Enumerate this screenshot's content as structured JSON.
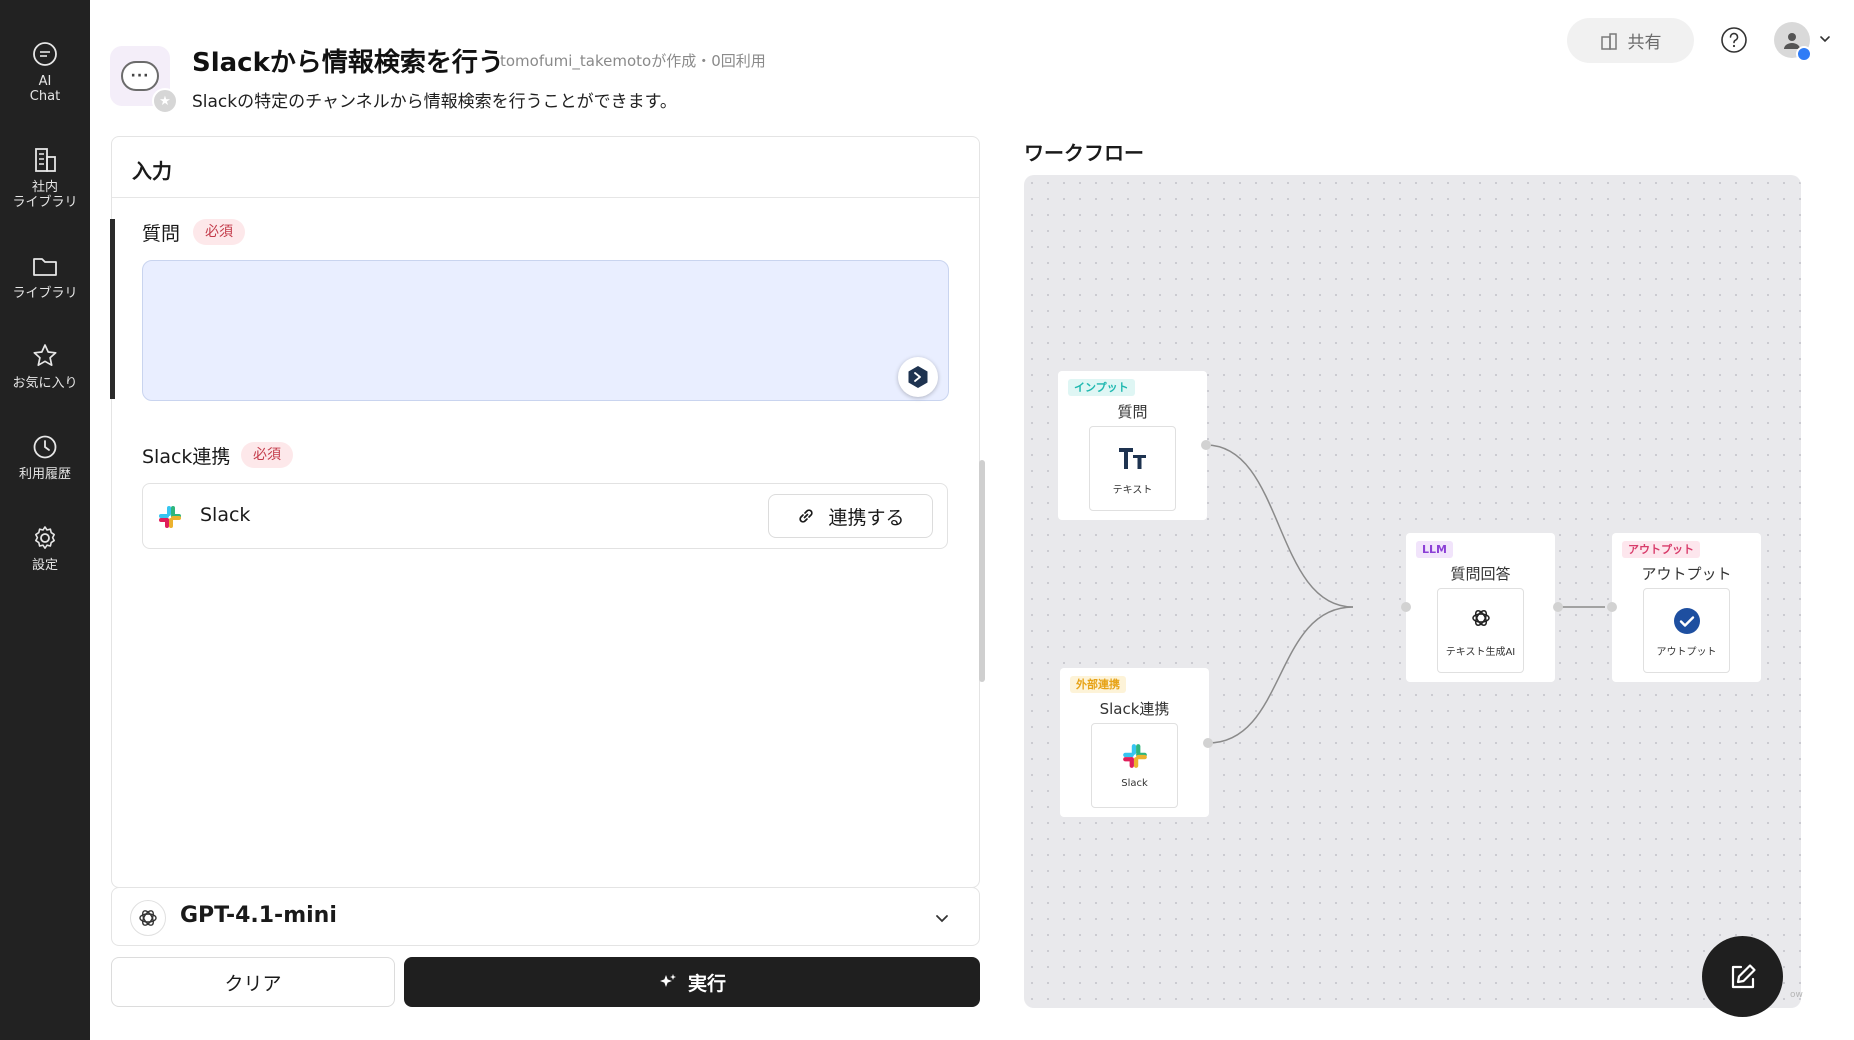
{
  "sidebar": {
    "items": [
      {
        "label": "AI\nChat",
        "icon": "chat-bubble-icon"
      },
      {
        "label": "社内\nライブラリ",
        "icon": "building-icon"
      },
      {
        "label": "ライブラリ",
        "icon": "folder-icon"
      },
      {
        "label": "お気に入り",
        "icon": "star-icon"
      },
      {
        "label": "利用履歴",
        "icon": "clock-icon"
      },
      {
        "label": "設定",
        "icon": "gear-icon"
      }
    ]
  },
  "header": {
    "title": "Slackから情報検索を行う",
    "meta": "tomofumi_takemotoが作成・0回利用",
    "description": "Slackの特定のチャンネルから情報検索を行うことができます。",
    "share_label": "共有"
  },
  "input_card": {
    "title": "入力",
    "question": {
      "label": "質問",
      "required": "必須",
      "value": "",
      "placeholder": ""
    },
    "slack": {
      "label": "Slack連携",
      "required": "必須",
      "service_name": "Slack",
      "connect_label": "連携する"
    }
  },
  "model": {
    "name": "GPT-4.1-mini"
  },
  "actions": {
    "clear_label": "クリア",
    "run_label": "実行"
  },
  "workflow": {
    "title": "ワークフロー",
    "nodes": {
      "input": {
        "tag": "インプット",
        "title": "質問",
        "inner_label": "テキスト"
      },
      "external": {
        "tag": "外部連携",
        "title": "Slack連携",
        "inner_label": "Slack"
      },
      "llm": {
        "tag": "LLM",
        "title": "質問回答",
        "inner_label": "テキスト生成AI"
      },
      "output": {
        "tag": "アウトプット",
        "title": "アウトプット",
        "inner_label": "アウトプット"
      }
    },
    "watermark": "ow"
  },
  "colors": {
    "sidebar_bg": "#222222",
    "accent_blue": "#2f7cf6",
    "required_bg": "#fde8ea",
    "required_text": "#c33b4a",
    "input_bg": "#e9eeff",
    "tag_input": "#1fb8b0",
    "tag_external": "#e7a317",
    "tag_llm": "#8b3fd6",
    "tag_output": "#d83b6a",
    "run_bg": "#1f1f1f"
  }
}
